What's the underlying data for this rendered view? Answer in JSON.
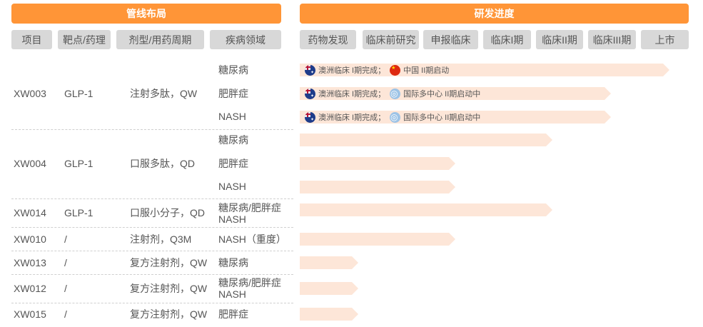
{
  "banners": {
    "pipeline": "管线布局",
    "progress": "研发进度"
  },
  "columns": {
    "project": "项目",
    "target": "靶点/药理",
    "dosage": "剂型/用药周期",
    "disease": "疾病领域",
    "stages": [
      "药物发现",
      "临床前研究",
      "申报临床",
      "临床I期",
      "临床II期",
      "临床III期",
      "上市"
    ]
  },
  "rows": [
    {
      "id": "XW003",
      "target": "GLP-1",
      "dosage": "注射多肽，QW",
      "diseases": [
        "糖尿病",
        "肥胖症",
        "NASH"
      ]
    },
    {
      "id": "XW004",
      "target": "GLP-1",
      "dosage": "口服多肽，QD",
      "diseases": [
        "糖尿病",
        "肥胖症",
        "NASH"
      ]
    },
    {
      "id": "XW014",
      "target": "GLP-1",
      "dosage": "口服小分子，QD",
      "diseases": [
        "糖尿病/肥胖症",
        "NASH"
      ]
    },
    {
      "id": "XW010",
      "target": "/",
      "dosage": "注射剂，Q3M",
      "diseases": [
        "NASH（重度）"
      ]
    },
    {
      "id": "XW013",
      "target": "/",
      "dosage": "复方注射剂，QW",
      "diseases": [
        "糖尿病"
      ]
    },
    {
      "id": "XW012",
      "target": "/",
      "dosage": "复方注射剂，QW",
      "diseases": [
        "糖尿病/肥胖症",
        "NASH"
      ]
    },
    {
      "id": "XW015",
      "target": "/",
      "dosage": "复方注射剂，QW",
      "diseases": [
        "肥胖症"
      ]
    }
  ],
  "bars": [
    {
      "progress": 0.95,
      "notes": [
        {
          "flag": "australia-flag-icon",
          "text": "澳洲临床 I期完成；"
        },
        {
          "flag": "china-flag-icon",
          "text": "中国 II期启动"
        }
      ]
    },
    {
      "progress": 0.8,
      "notes": [
        {
          "flag": "australia-flag-icon",
          "text": "澳洲临床 I期完成；"
        },
        {
          "flag": "un-emblem-icon",
          "text": "国际多中心 II期启动中"
        }
      ]
    },
    {
      "progress": 0.8,
      "notes": [
        {
          "flag": "australia-flag-icon",
          "text": "澳洲临床 I期完成；"
        },
        {
          "flag": "un-emblem-icon",
          "text": "国际多中心 II期启动中"
        }
      ]
    },
    {
      "progress": 0.65,
      "notes": []
    },
    {
      "progress": 0.4,
      "notes": []
    },
    {
      "progress": 0.4,
      "notes": []
    },
    {
      "progress": 0.65,
      "notes": []
    },
    {
      "progress": 0.4,
      "notes": []
    },
    {
      "progress": 0.15,
      "notes": []
    },
    {
      "progress": 0.15,
      "notes": []
    },
    {
      "progress": 0.15,
      "notes": []
    }
  ],
  "colors": {
    "banner": "#ff9537",
    "header_bg": "#d8d8d8",
    "bar_fill": "#fde6d8"
  }
}
